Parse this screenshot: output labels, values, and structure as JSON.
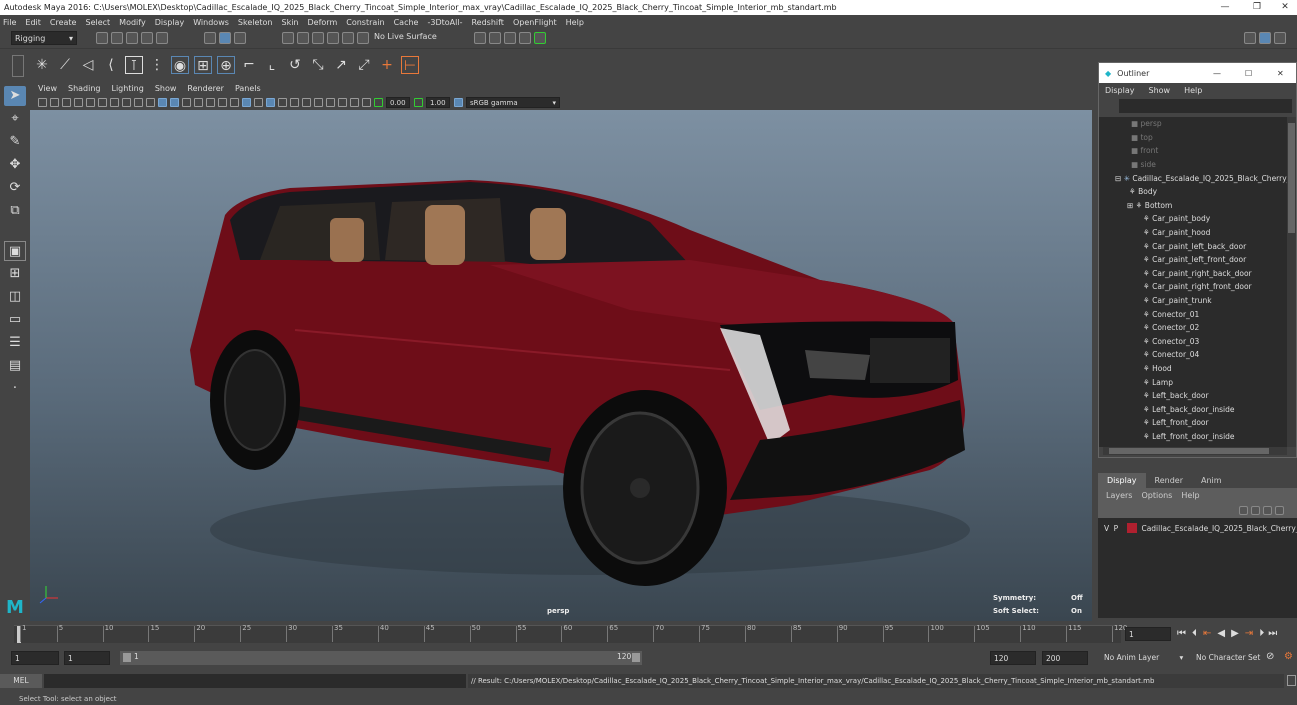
{
  "window": {
    "title": "Autodesk Maya 2016: C:\\Users\\MOLEX\\Desktop\\Cadillac_Escalade_IQ_2025_Black_Cherry_Tincoat_Simple_Interior_max_vray\\Cadillac_Escalade_IQ_2025_Black_Cherry_Tincoat_Simple_Interior_mb_standart.mb",
    "minimize": "—",
    "restore": "❐",
    "close": "✕"
  },
  "menubar": [
    "File",
    "Edit",
    "Create",
    "Select",
    "Modify",
    "Display",
    "Windows",
    "Skeleton",
    "Skin",
    "Deform",
    "Constrain",
    "Cache",
    "-3DtoAll-",
    "Redshift",
    "OpenFlight",
    "Help"
  ],
  "statusline": {
    "mode": "Rigging",
    "live_surface": "No Live Surface"
  },
  "viewport": {
    "menu": [
      "View",
      "Shading",
      "Lighting",
      "Show",
      "Renderer",
      "Panels"
    ],
    "exposure": "0.00",
    "gamma": "1.00",
    "colorspace": "sRGB gamma",
    "camera": "persp",
    "hud": {
      "symmetry_label": "Symmetry:",
      "symmetry_value": "Off",
      "soft_select_label": "Soft Select:",
      "soft_select_value": "On"
    }
  },
  "outliner": {
    "title": "Outliner",
    "menu": [
      "Display",
      "Show",
      "Help"
    ],
    "cameras": [
      "persp",
      "top",
      "front",
      "side"
    ],
    "root": "Cadillac_Escalade_IQ_2025_Black_Cherry_",
    "children": [
      "Body",
      "Bottom",
      "Car_paint_body",
      "Car_paint_hood",
      "Car_paint_left_back_door",
      "Car_paint_left_front_door",
      "Car_paint_right_back_door",
      "Car_paint_right_front_door",
      "Car_paint_trunk",
      "Conector_01",
      "Conector_02",
      "Conector_03",
      "Conector_04",
      "Hood",
      "Lamp",
      "Left_back_door",
      "Left_back_door_inside",
      "Left_front_door",
      "Left_front_door_inside"
    ]
  },
  "layer_editor": {
    "tabs": [
      "Display",
      "Render",
      "Anim"
    ],
    "menu": [
      "Layers",
      "Options",
      "Help"
    ],
    "layer": {
      "v": "V",
      "p": "P",
      "name": "Cadillac_Escalade_IQ_2025_Black_Cherry_T",
      "color": "#b0202f"
    }
  },
  "timeline": {
    "ticks": [
      "1",
      "5",
      "10",
      "15",
      "20",
      "25",
      "30",
      "35",
      "40",
      "45",
      "50",
      "55",
      "60",
      "65",
      "70",
      "75",
      "80",
      "85",
      "90",
      "95",
      "100",
      "105",
      "110",
      "115",
      "120"
    ],
    "current_frame": "1"
  },
  "range": {
    "start": "1",
    "playback_start": "1",
    "slider_start": "1",
    "slider_end": "120",
    "playback_end": "120",
    "end": "200",
    "anim_layer": "No Anim Layer",
    "character_set": "No Character Set"
  },
  "command": {
    "lang": "MEL",
    "result": "// Result: C:/Users/MOLEX/Desktop/Cadillac_Escalade_IQ_2025_Black_Cherry_Tincoat_Simple_Interior_max_vray/Cadillac_Escalade_IQ_2025_Black_Cherry_Tincoat_Simple_Interior_mb_standart.mb"
  },
  "help_line": "Select Tool: select an object",
  "colors": {
    "body_paint": "#7a0f1a",
    "accent": "#5a87b3"
  }
}
